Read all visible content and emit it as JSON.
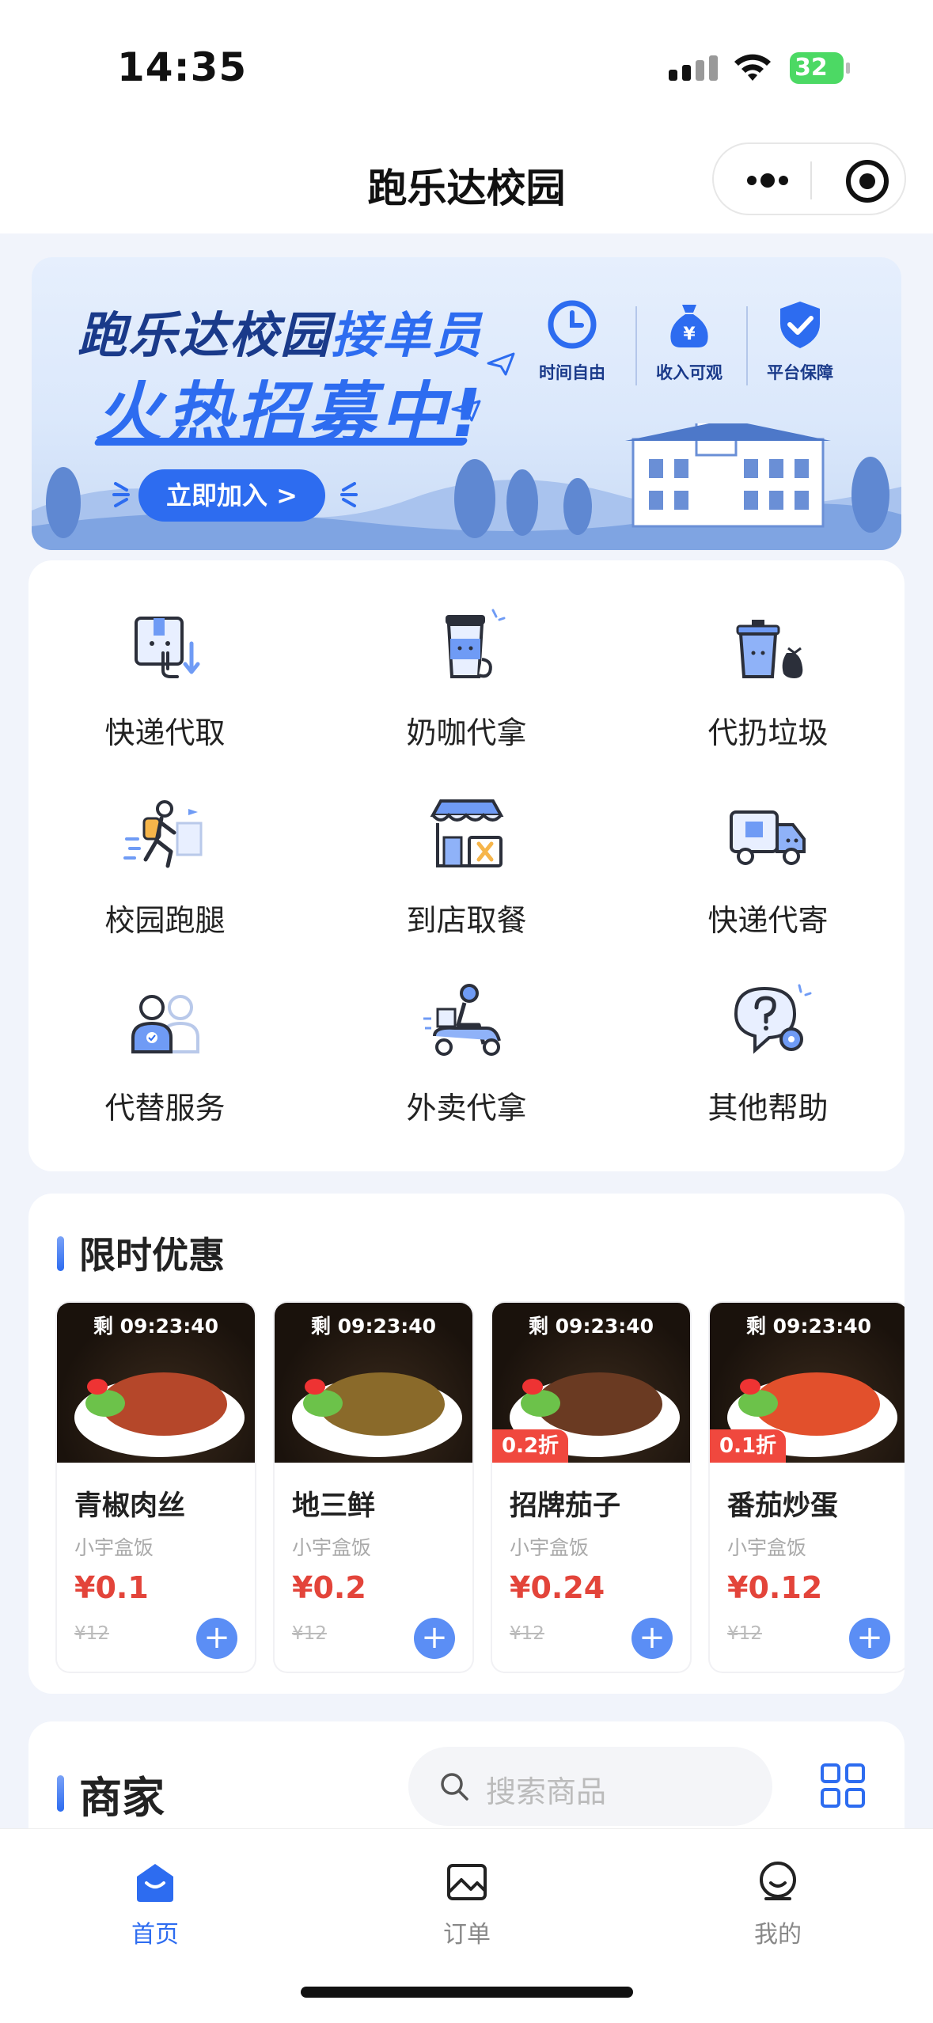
{
  "status_bar": {
    "time": "14:35",
    "battery": "32"
  },
  "nav": {
    "title": "跑乐达校园"
  },
  "banner": {
    "title_part1": "跑乐达校园",
    "title_part2": "接单员",
    "subtitle": "火热招募中!",
    "join_button": "立即加入 >",
    "features": [
      {
        "icon": "clock-icon",
        "label": "时间自由"
      },
      {
        "icon": "money-bag-icon",
        "label": "收入可观"
      },
      {
        "icon": "shield-check-icon",
        "label": "平台保障"
      }
    ]
  },
  "services": [
    {
      "icon": "package-pickup-icon",
      "label": "快递代取"
    },
    {
      "icon": "coffee-cup-icon",
      "label": "奶咖代拿"
    },
    {
      "icon": "trash-can-icon",
      "label": "代扔垃圾"
    },
    {
      "icon": "runner-icon",
      "label": "校园跑腿"
    },
    {
      "icon": "storefront-icon",
      "label": "到店取餐"
    },
    {
      "icon": "delivery-truck-icon",
      "label": "快递代寄"
    },
    {
      "icon": "substitute-person-icon",
      "label": "代替服务"
    },
    {
      "icon": "scooter-delivery-icon",
      "label": "外卖代拿"
    },
    {
      "icon": "help-gear-icon",
      "label": "其他帮助"
    }
  ],
  "deals": {
    "title": "限时优惠",
    "items": [
      {
        "timer": "剩 09:23:40",
        "name": "青椒肉丝",
        "shop": "小宇盒饭",
        "price": "¥0.1",
        "old_price": "¥12",
        "discount": "",
        "dish_color": "#b5472a"
      },
      {
        "timer": "剩 09:23:40",
        "name": "地三鲜",
        "shop": "小宇盒饭",
        "price": "¥0.2",
        "old_price": "¥12",
        "discount": "",
        "dish_color": "#8a6a2a"
      },
      {
        "timer": "剩 09:23:40",
        "name": "招牌茄子",
        "shop": "小宇盒饭",
        "price": "¥0.24",
        "old_price": "¥12",
        "discount": "0.2折",
        "dish_color": "#6a3a22"
      },
      {
        "timer": "剩 09:23:40",
        "name": "番茄炒蛋",
        "shop": "小宇盒饭",
        "price": "¥0.12",
        "old_price": "¥12",
        "discount": "0.1折",
        "dish_color": "#e2502c"
      }
    ]
  },
  "merchants": {
    "title": "商家",
    "search_placeholder": "搜索商品"
  },
  "tabbar": [
    {
      "icon": "home-icon",
      "label": "首页",
      "active": true
    },
    {
      "icon": "orders-icon",
      "label": "订单",
      "active": false
    },
    {
      "icon": "profile-icon",
      "label": "我的",
      "active": false
    }
  ],
  "colors": {
    "accent": "#2d6cf0",
    "price": "#e3443a",
    "discount": "#f0483e"
  }
}
